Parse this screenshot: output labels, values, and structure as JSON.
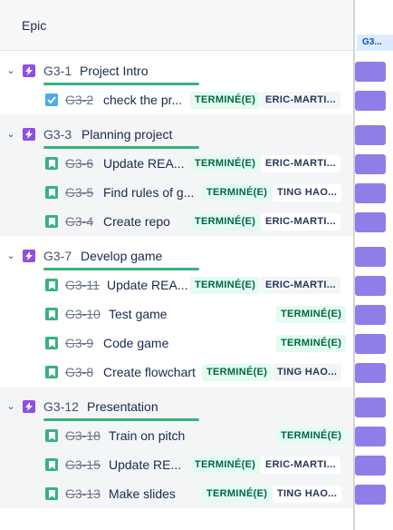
{
  "header": {
    "column_title": "Epic"
  },
  "timeline": {
    "sprint_label": "G3..."
  },
  "colors": {
    "epic_icon": "#904ee2",
    "story_icon": "#36b37e",
    "task_icon": "#4bade8",
    "bar": "#8f7ee7",
    "status_bg": "#e3fcef",
    "status_text": "#006644",
    "progress": "#36b37e"
  },
  "epics": [
    {
      "key": "G3-1",
      "name": "Project Intro",
      "progress": 1.0,
      "children": [
        {
          "type": "task",
          "key": "G3-2",
          "name": "check the pr...",
          "status": "TERMINÉ(E)",
          "assignee": "ERIC-MARTI..."
        }
      ]
    },
    {
      "key": "G3-3",
      "name": "Planning project",
      "progress": 1.0,
      "children": [
        {
          "type": "story",
          "key": "G3-6",
          "name": "Update REA...",
          "status": "TERMINÉ(E)",
          "assignee": "ERIC-MARTI..."
        },
        {
          "type": "story",
          "key": "G3-5",
          "name": "Find rules of g...",
          "status": "TERMINÉ(E)",
          "assignee": "TING HAO..."
        },
        {
          "type": "story",
          "key": "G3-4",
          "name": "Create repo",
          "status": "TERMINÉ(E)",
          "assignee": "ERIC-MARTI..."
        }
      ]
    },
    {
      "key": "G3-7",
      "name": "Develop game",
      "progress": 1.0,
      "children": [
        {
          "type": "story",
          "key": "G3-11",
          "name": "Update REA...",
          "status": "TERMINÉ(E)",
          "assignee": "ERIC-MARTI..."
        },
        {
          "type": "story",
          "key": "G3-10",
          "name": "Test game",
          "status": "TERMINÉ(E)",
          "assignee": ""
        },
        {
          "type": "story",
          "key": "G3-9",
          "name": "Code game",
          "status": "TERMINÉ(E)",
          "assignee": ""
        },
        {
          "type": "story",
          "key": "G3-8",
          "name": "Create flowchart",
          "status": "TERMINÉ(E)",
          "assignee": "TING HAO..."
        }
      ]
    },
    {
      "key": "G3-12",
      "name": "Presentation",
      "progress": 1.0,
      "children": [
        {
          "type": "story",
          "key": "G3-18",
          "name": "Train on pitch",
          "status": "TERMINÉ(E)",
          "assignee": ""
        },
        {
          "type": "story",
          "key": "G3-15",
          "name": "Update RE...",
          "status": "TERMINÉ(E)",
          "assignee": "ERIC-MARTI..."
        },
        {
          "type": "story",
          "key": "G3-13",
          "name": "Make slides",
          "status": "TERMINÉ(E)",
          "assignee": "TING HAO..."
        }
      ]
    }
  ]
}
